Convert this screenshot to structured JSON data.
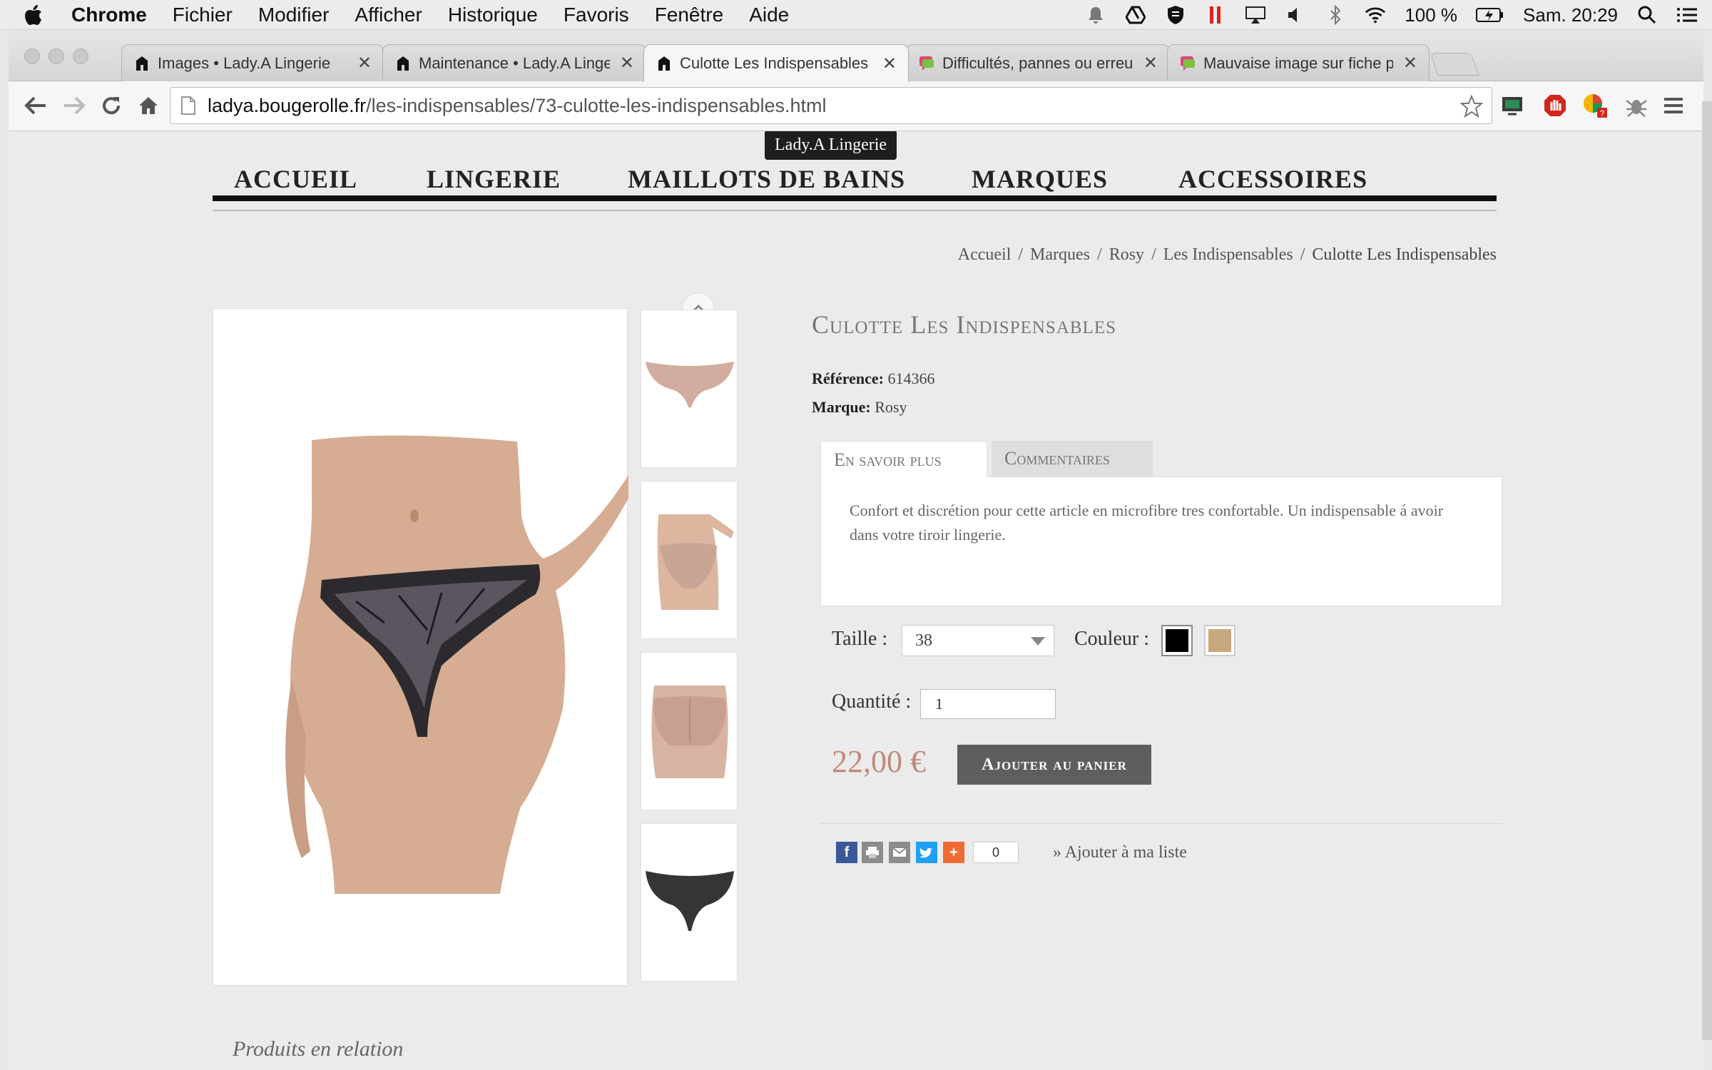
{
  "menubar": {
    "app": "Chrome",
    "items": [
      "Fichier",
      "Modifier",
      "Afficher",
      "Historique",
      "Favoris",
      "Fenêtre",
      "Aide"
    ],
    "battery": "100 %",
    "clock": "Sam. 20:29"
  },
  "tabs": [
    {
      "title": "Images • Lady.A Lingerie"
    },
    {
      "title": "Maintenance • Lady.A Lingerie"
    },
    {
      "title": "Culotte Les Indispensables"
    },
    {
      "title": "Difficultés, pannes ou erreurs"
    },
    {
      "title": "Mauvaise image sur fiche produit"
    }
  ],
  "address": {
    "host": "ladya.bougerolle.fr",
    "path": "/les-indispensables/73-culotte-les-indispensables.html"
  },
  "tooltip": "Lady.A Lingerie",
  "nav": [
    "ACCUEIL",
    "LINGERIE",
    "MAILLOTS DE BAINS",
    "MARQUES",
    "ACCESSOIRES"
  ],
  "breadcrumb": [
    "Accueil",
    "Marques",
    "Rosy",
    "Les Indispensables",
    "Culotte Les Indispensables"
  ],
  "product": {
    "title": "Culotte Les Indispensables",
    "reference_label": "Référence:",
    "reference": "614366",
    "brand_label": "Marque:",
    "brand": "Rosy",
    "tabs": [
      "En savoir plus",
      "Commentaires"
    ],
    "description": "Confort et discrétion pour cette article en microfibre tres confortable. Un indispensable á avoir dans  votre tiroir lingerie.",
    "size_label": "Taille :",
    "size_value": "38",
    "color_label": "Couleur :",
    "colors": [
      "#000000",
      "#c9a77c"
    ],
    "qty_label": "Quantité :",
    "qty_value": "1",
    "price": "22,00 €",
    "add_to_cart": "Ajouter au panier",
    "share_count": "0",
    "wishlist": "» Ajouter à ma liste"
  },
  "related_title": "Produits en relation",
  "colors": {
    "price": "#c08a7a",
    "button": "#5e5e5e",
    "facebook": "#3b5998",
    "twitter": "#1da1f2",
    "plus": "#f06a35"
  }
}
